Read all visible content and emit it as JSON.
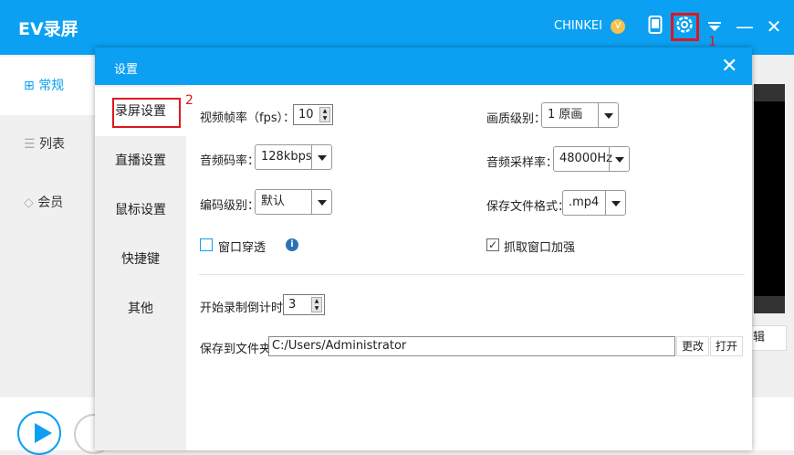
{
  "app": {
    "title": "EV录屏",
    "user": "CHINKEI",
    "vip_badge": "V",
    "annotation_1": "1",
    "annotation_2": "2"
  },
  "sidebar": {
    "items": [
      {
        "label": "常规",
        "icon": "grid-icon",
        "active": true
      },
      {
        "label": "列表",
        "icon": "list-icon"
      },
      {
        "label": "会员",
        "icon": "diamond-icon"
      }
    ]
  },
  "main": {
    "edit_label": "辑"
  },
  "dialog": {
    "title": "设置",
    "nav": [
      "录屏设置",
      "直播设置",
      "鼠标设置",
      "快捷键",
      "其他"
    ],
    "fps": {
      "label": "视频帧率（fps）：",
      "value": "10"
    },
    "quality": {
      "label": "画质级别：",
      "value": "1 原画"
    },
    "audio_bitrate": {
      "label": "音频码率：",
      "value": "128kbps"
    },
    "sample_rate": {
      "label": "音频采样率：",
      "value": "48000Hz"
    },
    "encode_level": {
      "label": "编码级别：",
      "value": "默认"
    },
    "format": {
      "label": "保存文件格式：",
      "value": ".mp4"
    },
    "window_through": {
      "label": "窗口穿透",
      "checked": false
    },
    "capture_enhance": {
      "label": "抓取窗口加强",
      "checked": true
    },
    "countdown": {
      "label": "开始录制倒计时：",
      "value": "3"
    },
    "save_path": {
      "label": "保存到文件夹：",
      "value": "C:/Users/Administrator",
      "change": "更改",
      "open": "打开"
    }
  },
  "colors": {
    "accent": "#0ba0f2",
    "annotation": "#e0161e"
  }
}
